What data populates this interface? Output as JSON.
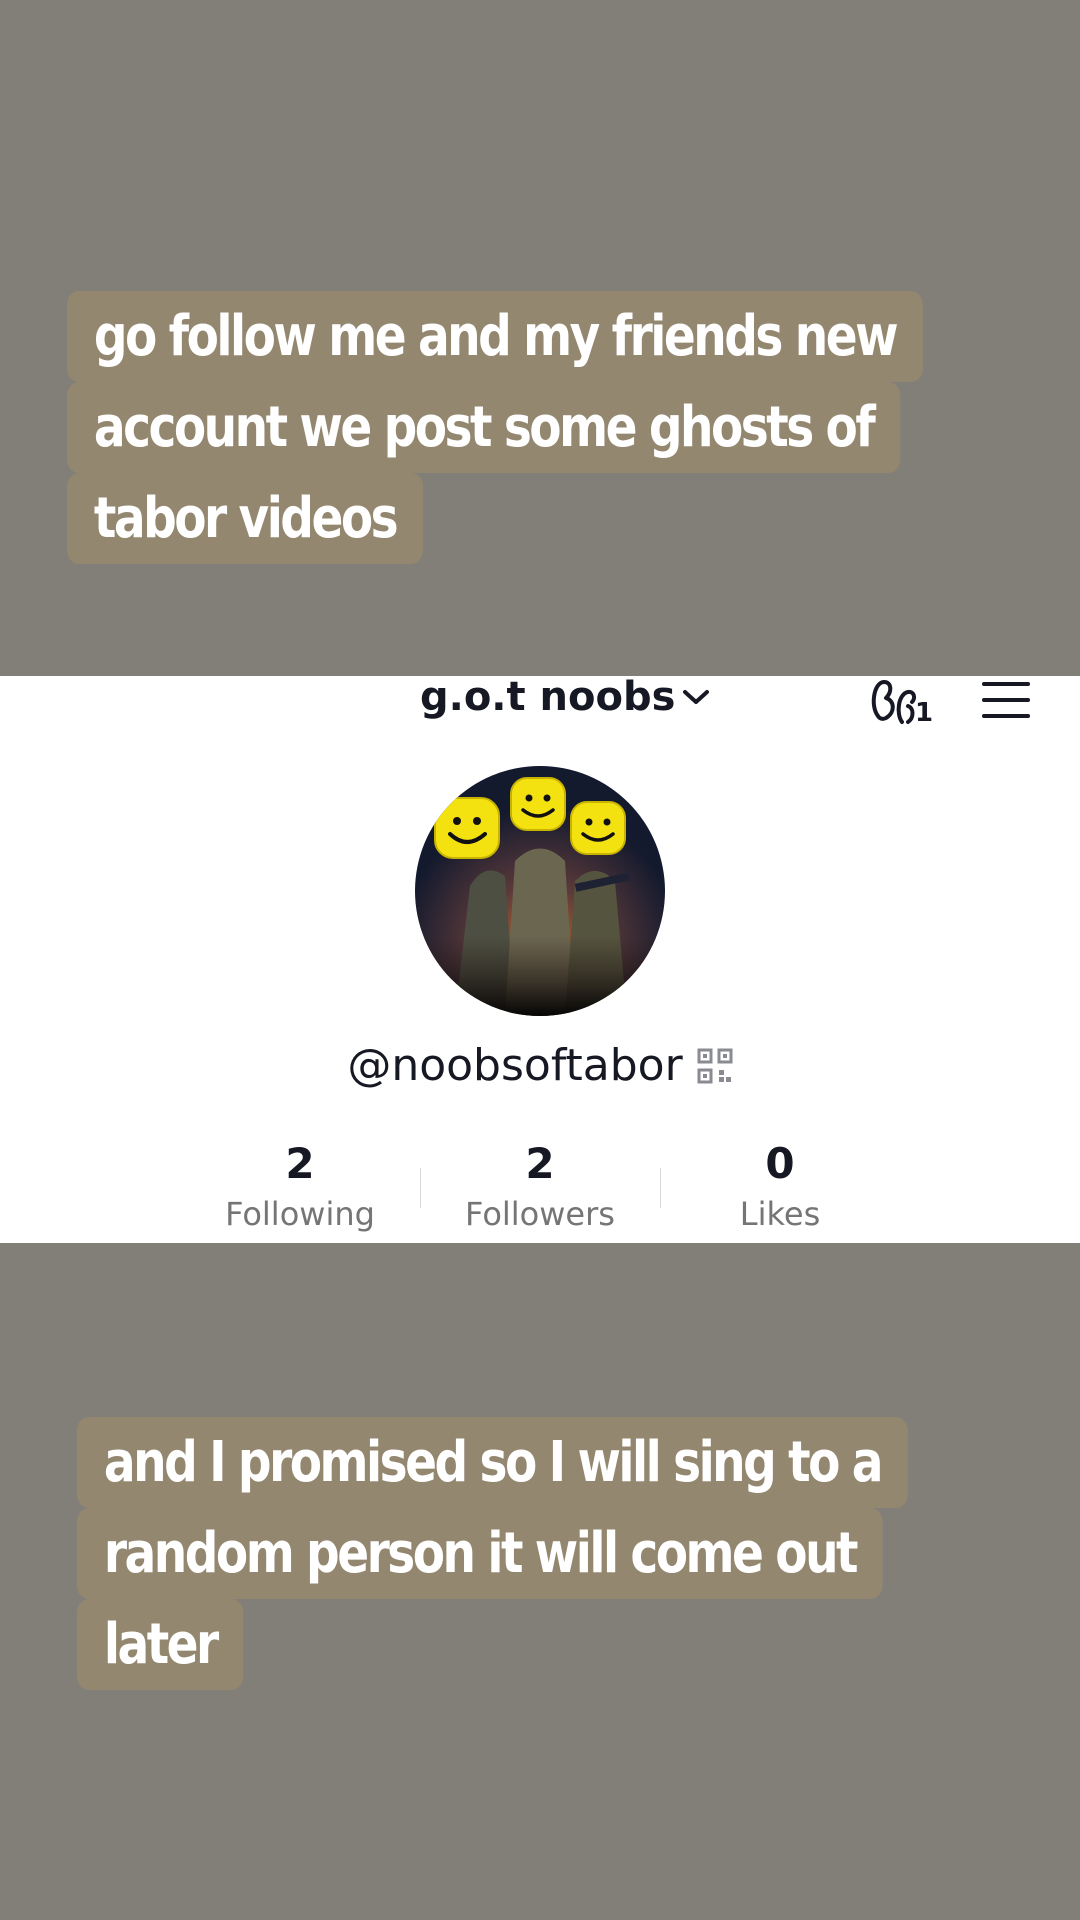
{
  "captions": {
    "top": [
      "go follow me and my friends new",
      "account we post some ghosts of",
      "tabor videos"
    ],
    "bottom": [
      "and I promised so I will sing to a",
      "random person it will come out",
      "later"
    ]
  },
  "profile": {
    "account_name": "g.o.t noobs",
    "friends_badge": "1",
    "handle": "@noobsoftabor",
    "stats": [
      {
        "value": "2",
        "label": "Following"
      },
      {
        "value": "2",
        "label": "Followers"
      },
      {
        "value": "0",
        "label": "Likes"
      }
    ]
  },
  "icons": {
    "account_switch": "chevron-down-icon",
    "friends": "friends-icon",
    "menu": "menu-icon",
    "qr": "qr-code-icon"
  },
  "colors": {
    "background": "#827f79",
    "caption_bg": "#948770",
    "panel_bg": "#ffffff"
  }
}
